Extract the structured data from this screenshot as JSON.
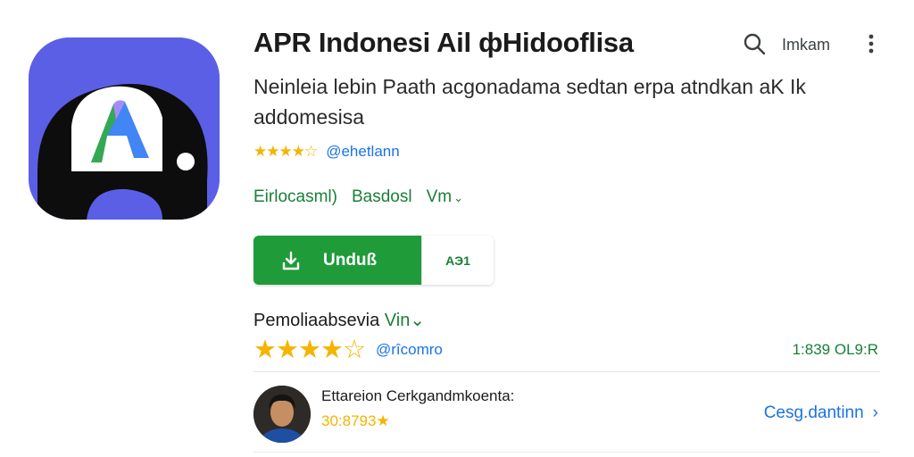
{
  "app": {
    "title": "APR Indonesi Ail фHidooflisa",
    "description": "Neinleia lebin Paath acgonadama sedtan erpa atndkan aK Ik addomesisa",
    "developer_stars": "★★★★☆",
    "developer_link": "@ehetlann",
    "meta": {
      "category": "Eirlocasml)",
      "publisher": "Basdosl",
      "version_label": "Vm",
      "version_chevron": "⌄"
    }
  },
  "header": {
    "search_icon": "search-icon",
    "link_label": "Imkam",
    "more_icon": "more-vert-icon"
  },
  "actions": {
    "install_label": "Unduß",
    "secondary_label": "AЭ1"
  },
  "ratings": {
    "section_title": "Pemoliaabsevia",
    "section_accent": "Vin⌄",
    "stars": "★★★★☆",
    "rating_value": 4.5,
    "link_label": "@rîcomro",
    "count": "1:839 OL9:R"
  },
  "review": {
    "title": "Ettareion Cerkgandmkoenta:",
    "score": "30:8793★",
    "link_label": "Cesg.dantinn",
    "link_chevron": "›"
  },
  "colors": {
    "accent_green": "#1f9b3a",
    "link_blue": "#1a73e8",
    "star_yellow": "#f4b400",
    "icon_purple": "#5b5fe6"
  }
}
